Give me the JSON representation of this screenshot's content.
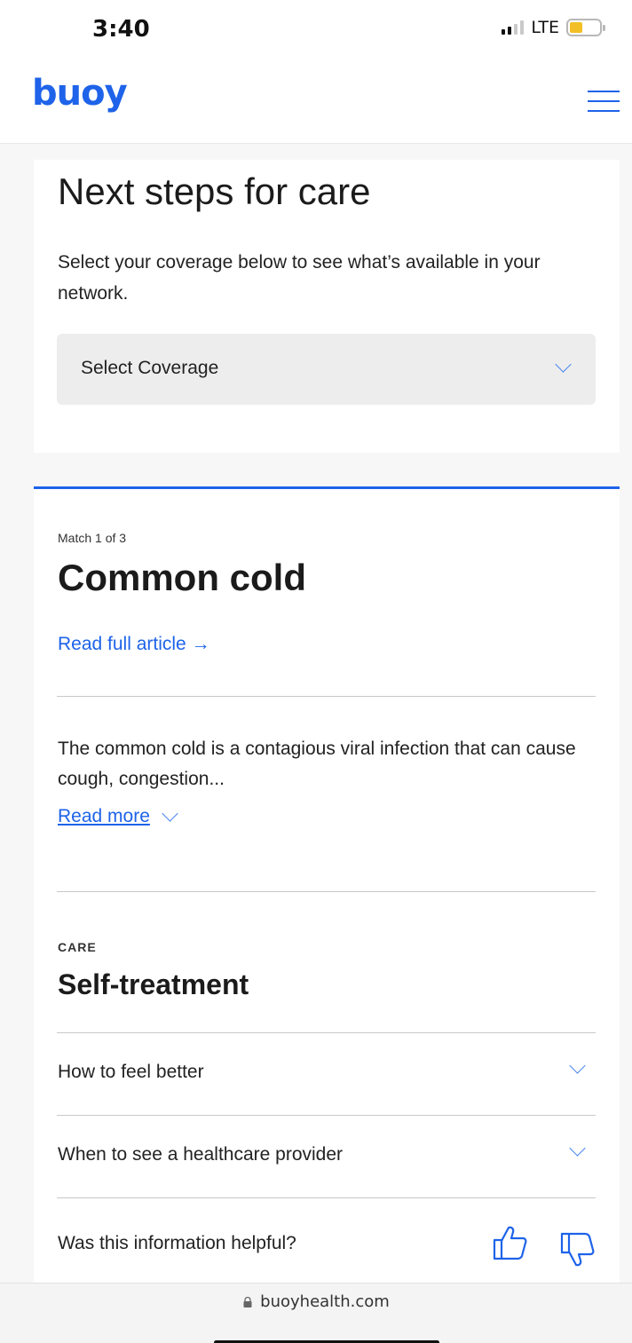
{
  "status_bar": {
    "time": "3:40",
    "network": "LTE",
    "battery_level": 0.35,
    "battery_color": "#f2c026"
  },
  "header": {
    "logo": "buoy",
    "menu_icon": "hamburger-menu-icon",
    "accent_color": "#1e63e9"
  },
  "care_card": {
    "title": "Next steps for care",
    "description": "Select your coverage below to see what’s available in your network.",
    "coverage_select": {
      "value": "Select Coverage",
      "icon": "chevron-down-icon"
    }
  },
  "match_card": {
    "match_count": "Match 1 of 3",
    "condition": "Common cold",
    "read_full_article": "Read full article →",
    "summary": "The common cold is a contagious viral infection that can cause cough, congestion...",
    "read_more": "Read more",
    "care_tag": "CARE",
    "care_type": "Self-treatment",
    "accordion": [
      {
        "label": "How to feel better",
        "icon": "chevron-down-icon"
      },
      {
        "label": "When to see a healthcare provider",
        "icon": "chevron-down-icon"
      }
    ],
    "feedback": {
      "question": "Was this information helpful?",
      "icons": [
        "thumbs-up-icon",
        "thumbs-down-icon"
      ]
    }
  },
  "browser": {
    "url": "buoyhealth.com",
    "icon": "lock-icon"
  }
}
